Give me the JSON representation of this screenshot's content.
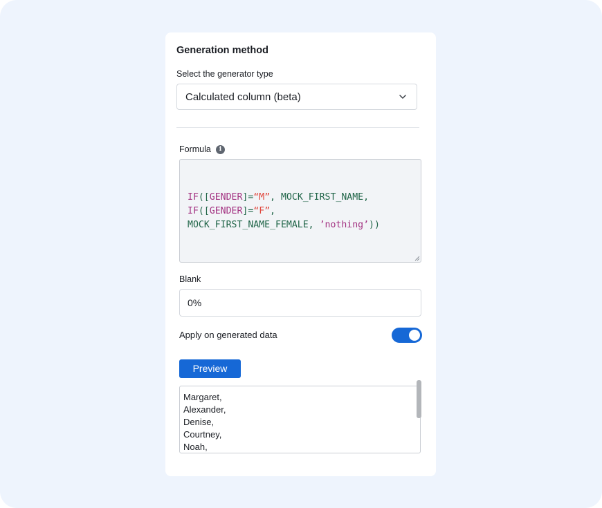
{
  "panel": {
    "title": "Generation method",
    "generator_label": "Select the generator type",
    "generator_value": "Calculated column (beta)",
    "formula_label": "Formula",
    "formula_lines": [
      [
        {
          "t": "IF",
          "c": "kw"
        },
        {
          "t": "([",
          "c": "pun"
        },
        {
          "t": "GENDER",
          "c": "kw"
        },
        {
          "t": "]=",
          "c": "pun"
        },
        {
          "t": "“M”",
          "c": "str"
        },
        {
          "t": ", MOCK_FIRST_NAME,",
          "c": "id"
        }
      ],
      [
        {
          "t": "IF",
          "c": "kw"
        },
        {
          "t": "([",
          "c": "pun"
        },
        {
          "t": "GENDER",
          "c": "kw"
        },
        {
          "t": "]=",
          "c": "pun"
        },
        {
          "t": "“F”",
          "c": "str"
        },
        {
          "t": ",",
          "c": "id"
        }
      ],
      [
        {
          "t": "MOCK_FIRST_NAME_FEMALE, ",
          "c": "id"
        },
        {
          "t": "’nothing’",
          "c": "sq"
        },
        {
          "t": "))",
          "c": "id"
        }
      ]
    ],
    "blank_label": "Blank",
    "blank_value": "0%",
    "apply_label": "Apply on generated data",
    "apply_on": true,
    "preview_button": "Preview",
    "preview_items": [
      "Margaret,",
      "Alexander,",
      "Denise,",
      "Courtney,",
      "Noah,"
    ]
  },
  "colors": {
    "accent": "#1668d6",
    "background": "#eef4fd",
    "keyword": "#a23080",
    "string": "#e0453b",
    "identifier": "#1f6447"
  },
  "icons": {
    "chevron": "chevron-down-icon",
    "info": "info-icon"
  }
}
